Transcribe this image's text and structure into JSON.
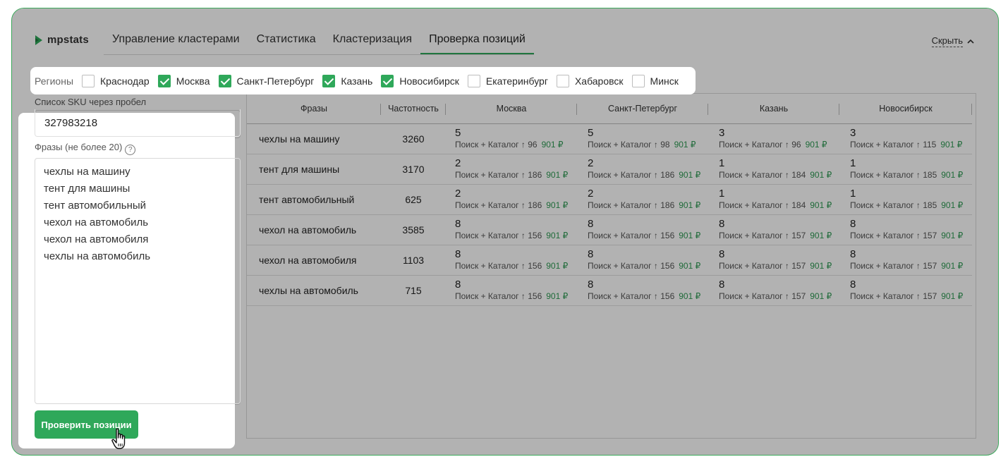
{
  "brand": {
    "name": "mpstats"
  },
  "tabs": [
    {
      "label": "Управление кластерами"
    },
    {
      "label": "Статистика"
    },
    {
      "label": "Кластеризация"
    },
    {
      "label": "Проверка позиций",
      "active": true
    }
  ],
  "hide_link": {
    "label": "Скрыть"
  },
  "regions": {
    "label": "Регионы",
    "items": [
      {
        "name": "Краснодар",
        "checked": false
      },
      {
        "name": "Москва",
        "checked": true
      },
      {
        "name": "Санкт-Петербург",
        "checked": true
      },
      {
        "name": "Казань",
        "checked": true
      },
      {
        "name": "Новосибирск",
        "checked": true
      },
      {
        "name": "Екатеринбург",
        "checked": false
      },
      {
        "name": "Хабаровск",
        "checked": false
      },
      {
        "name": "Минск",
        "checked": false
      }
    ]
  },
  "sku": {
    "label": "Список SKU через пробел",
    "value": "327983218"
  },
  "phrases_input": {
    "label": "Фразы (не более 20)",
    "lines": [
      "чехлы на машину",
      "тент для машины",
      "тент автомобильный",
      "чехол на автомобиль",
      "чехол на автомобиля",
      "чехлы на автомобиль"
    ]
  },
  "check_button": {
    "label": "Проверить позиции"
  },
  "table": {
    "headers": [
      "Фразы",
      "Частотность",
      "Москва",
      "Санкт-Петербург",
      "Казань",
      "Новосибирск"
    ],
    "rows": [
      {
        "phrase": "чехлы на машину",
        "freq": "3260",
        "cells": [
          {
            "pos": "5",
            "sub": "Поиск + Каталог ↑ 96",
            "price": "901 ₽"
          },
          {
            "pos": "5",
            "sub": "Поиск + Каталог ↑ 98",
            "price": "901 ₽"
          },
          {
            "pos": "3",
            "sub": "Поиск + Каталог ↑ 96",
            "price": "901 ₽"
          },
          {
            "pos": "3",
            "sub": "Поиск + Каталог ↑ 115",
            "price": "901 ₽"
          }
        ]
      },
      {
        "phrase": "тент для машины",
        "freq": "3170",
        "cells": [
          {
            "pos": "2",
            "sub": "Поиск + Каталог ↑ 186",
            "price": "901 ₽"
          },
          {
            "pos": "2",
            "sub": "Поиск + Каталог ↑ 186",
            "price": "901 ₽"
          },
          {
            "pos": "1",
            "sub": "Поиск + Каталог ↑ 184",
            "price": "901 ₽"
          },
          {
            "pos": "1",
            "sub": "Поиск + Каталог ↑ 185",
            "price": "901 ₽"
          }
        ]
      },
      {
        "phrase": "тент автомобильный",
        "freq": "625",
        "cells": [
          {
            "pos": "2",
            "sub": "Поиск + Каталог ↑ 186",
            "price": "901 ₽"
          },
          {
            "pos": "2",
            "sub": "Поиск + Каталог ↑ 186",
            "price": "901 ₽"
          },
          {
            "pos": "1",
            "sub": "Поиск + Каталог ↑ 184",
            "price": "901 ₽"
          },
          {
            "pos": "1",
            "sub": "Поиск + Каталог ↑ 185",
            "price": "901 ₽"
          }
        ]
      },
      {
        "phrase": "чехол на автомобиль",
        "freq": "3585",
        "cells": [
          {
            "pos": "8",
            "sub": "Поиск + Каталог ↑ 156",
            "price": "901 ₽"
          },
          {
            "pos": "8",
            "sub": "Поиск + Каталог ↑ 156",
            "price": "901 ₽"
          },
          {
            "pos": "8",
            "sub": "Поиск + Каталог ↑ 157",
            "price": "901 ₽"
          },
          {
            "pos": "8",
            "sub": "Поиск + Каталог ↑ 157",
            "price": "901 ₽"
          }
        ]
      },
      {
        "phrase": "чехол на автомобиля",
        "freq": "1103",
        "cells": [
          {
            "pos": "8",
            "sub": "Поиск + Каталог ↑ 156",
            "price": "901 ₽"
          },
          {
            "pos": "8",
            "sub": "Поиск + Каталог ↑ 156",
            "price": "901 ₽"
          },
          {
            "pos": "8",
            "sub": "Поиск + Каталог ↑ 157",
            "price": "901 ₽"
          },
          {
            "pos": "8",
            "sub": "Поиск + Каталог ↑ 157",
            "price": "901 ₽"
          }
        ]
      },
      {
        "phrase": "чехлы на автомобиль",
        "freq": "715",
        "cells": [
          {
            "pos": "8",
            "sub": "Поиск + Каталог ↑ 156",
            "price": "901 ₽"
          },
          {
            "pos": "8",
            "sub": "Поиск + Каталог ↑ 156",
            "price": "901 ₽"
          },
          {
            "pos": "8",
            "sub": "Поиск + Каталог ↑ 157",
            "price": "901 ₽"
          },
          {
            "pos": "8",
            "sub": "Поиск + Каталог ↑ 157",
            "price": "901 ₽"
          }
        ]
      }
    ]
  },
  "colors": {
    "accent": "#2fa85a",
    "price": "#2e9a53",
    "overlay": "rgba(0,0,0,0.30)"
  }
}
